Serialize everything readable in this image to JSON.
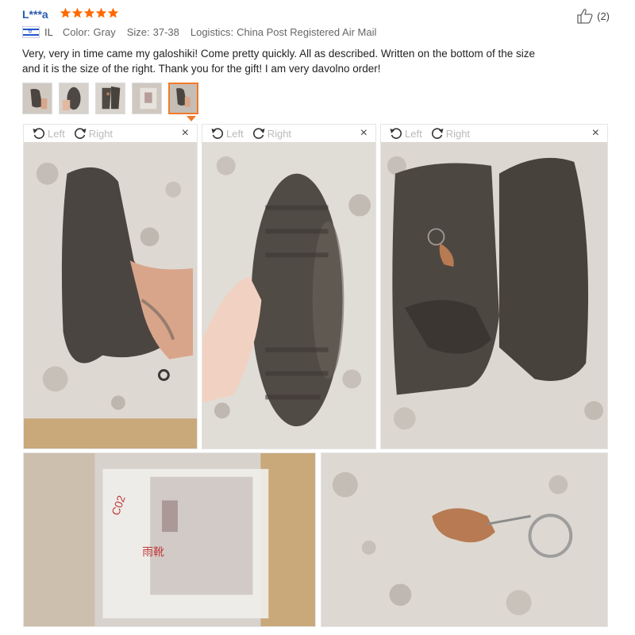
{
  "review": {
    "reviewer": "L***a",
    "rating": 5,
    "country_code": "IL",
    "color_label": "Color:",
    "color_value": "Gray",
    "size_label": "Size:",
    "size_value": "37-38",
    "logistics_label": "Logistics:",
    "logistics_value": "China Post Registered Air Mail",
    "helpful_count": "(2)",
    "text": "Very, very in time came my galoshiki! Come pretty quickly. All as described. Written on the bottom of the size and it is the size of the right. Thank you for the gift! I am very davolno order!"
  },
  "thumbnails": [
    {
      "icon": "photo-thumbnail",
      "active": false
    },
    {
      "icon": "photo-thumbnail",
      "active": false
    },
    {
      "icon": "photo-thumbnail",
      "active": false
    },
    {
      "icon": "photo-thumbnail",
      "active": false
    },
    {
      "icon": "photo-thumbnail",
      "active": true
    }
  ],
  "viewer": {
    "left_label": "Left",
    "right_label": "Right",
    "close_glyph": "×"
  },
  "colors": {
    "accent": "#f07a2a",
    "star": "#ff6a00",
    "reviewer": "#2a5bb0"
  }
}
